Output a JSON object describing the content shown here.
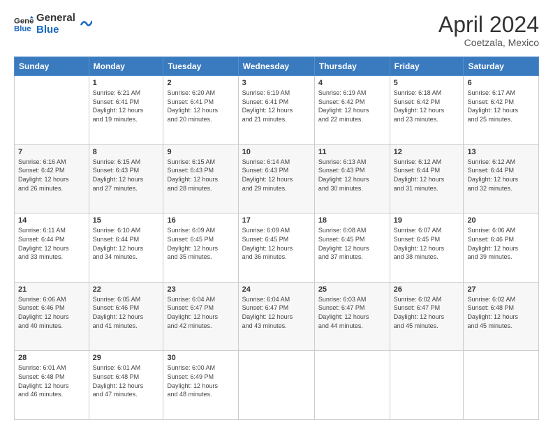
{
  "logo": {
    "line1": "General",
    "line2": "Blue"
  },
  "title": "April 2024",
  "subtitle": "Coetzala, Mexico",
  "days_header": [
    "Sunday",
    "Monday",
    "Tuesday",
    "Wednesday",
    "Thursday",
    "Friday",
    "Saturday"
  ],
  "weeks": [
    [
      {
        "day": "",
        "info": ""
      },
      {
        "day": "1",
        "info": "Sunrise: 6:21 AM\nSunset: 6:41 PM\nDaylight: 12 hours\nand 19 minutes."
      },
      {
        "day": "2",
        "info": "Sunrise: 6:20 AM\nSunset: 6:41 PM\nDaylight: 12 hours\nand 20 minutes."
      },
      {
        "day": "3",
        "info": "Sunrise: 6:19 AM\nSunset: 6:41 PM\nDaylight: 12 hours\nand 21 minutes."
      },
      {
        "day": "4",
        "info": "Sunrise: 6:19 AM\nSunset: 6:42 PM\nDaylight: 12 hours\nand 22 minutes."
      },
      {
        "day": "5",
        "info": "Sunrise: 6:18 AM\nSunset: 6:42 PM\nDaylight: 12 hours\nand 23 minutes."
      },
      {
        "day": "6",
        "info": "Sunrise: 6:17 AM\nSunset: 6:42 PM\nDaylight: 12 hours\nand 25 minutes."
      }
    ],
    [
      {
        "day": "7",
        "info": "Sunrise: 6:16 AM\nSunset: 6:42 PM\nDaylight: 12 hours\nand 26 minutes."
      },
      {
        "day": "8",
        "info": "Sunrise: 6:15 AM\nSunset: 6:43 PM\nDaylight: 12 hours\nand 27 minutes."
      },
      {
        "day": "9",
        "info": "Sunrise: 6:15 AM\nSunset: 6:43 PM\nDaylight: 12 hours\nand 28 minutes."
      },
      {
        "day": "10",
        "info": "Sunrise: 6:14 AM\nSunset: 6:43 PM\nDaylight: 12 hours\nand 29 minutes."
      },
      {
        "day": "11",
        "info": "Sunrise: 6:13 AM\nSunset: 6:43 PM\nDaylight: 12 hours\nand 30 minutes."
      },
      {
        "day": "12",
        "info": "Sunrise: 6:12 AM\nSunset: 6:44 PM\nDaylight: 12 hours\nand 31 minutes."
      },
      {
        "day": "13",
        "info": "Sunrise: 6:12 AM\nSunset: 6:44 PM\nDaylight: 12 hours\nand 32 minutes."
      }
    ],
    [
      {
        "day": "14",
        "info": "Sunrise: 6:11 AM\nSunset: 6:44 PM\nDaylight: 12 hours\nand 33 minutes."
      },
      {
        "day": "15",
        "info": "Sunrise: 6:10 AM\nSunset: 6:44 PM\nDaylight: 12 hours\nand 34 minutes."
      },
      {
        "day": "16",
        "info": "Sunrise: 6:09 AM\nSunset: 6:45 PM\nDaylight: 12 hours\nand 35 minutes."
      },
      {
        "day": "17",
        "info": "Sunrise: 6:09 AM\nSunset: 6:45 PM\nDaylight: 12 hours\nand 36 minutes."
      },
      {
        "day": "18",
        "info": "Sunrise: 6:08 AM\nSunset: 6:45 PM\nDaylight: 12 hours\nand 37 minutes."
      },
      {
        "day": "19",
        "info": "Sunrise: 6:07 AM\nSunset: 6:45 PM\nDaylight: 12 hours\nand 38 minutes."
      },
      {
        "day": "20",
        "info": "Sunrise: 6:06 AM\nSunset: 6:46 PM\nDaylight: 12 hours\nand 39 minutes."
      }
    ],
    [
      {
        "day": "21",
        "info": "Sunrise: 6:06 AM\nSunset: 6:46 PM\nDaylight: 12 hours\nand 40 minutes."
      },
      {
        "day": "22",
        "info": "Sunrise: 6:05 AM\nSunset: 6:46 PM\nDaylight: 12 hours\nand 41 minutes."
      },
      {
        "day": "23",
        "info": "Sunrise: 6:04 AM\nSunset: 6:47 PM\nDaylight: 12 hours\nand 42 minutes."
      },
      {
        "day": "24",
        "info": "Sunrise: 6:04 AM\nSunset: 6:47 PM\nDaylight: 12 hours\nand 43 minutes."
      },
      {
        "day": "25",
        "info": "Sunrise: 6:03 AM\nSunset: 6:47 PM\nDaylight: 12 hours\nand 44 minutes."
      },
      {
        "day": "26",
        "info": "Sunrise: 6:02 AM\nSunset: 6:47 PM\nDaylight: 12 hours\nand 45 minutes."
      },
      {
        "day": "27",
        "info": "Sunrise: 6:02 AM\nSunset: 6:48 PM\nDaylight: 12 hours\nand 45 minutes."
      }
    ],
    [
      {
        "day": "28",
        "info": "Sunrise: 6:01 AM\nSunset: 6:48 PM\nDaylight: 12 hours\nand 46 minutes."
      },
      {
        "day": "29",
        "info": "Sunrise: 6:01 AM\nSunset: 6:48 PM\nDaylight: 12 hours\nand 47 minutes."
      },
      {
        "day": "30",
        "info": "Sunrise: 6:00 AM\nSunset: 6:49 PM\nDaylight: 12 hours\nand 48 minutes."
      },
      {
        "day": "",
        "info": ""
      },
      {
        "day": "",
        "info": ""
      },
      {
        "day": "",
        "info": ""
      },
      {
        "day": "",
        "info": ""
      }
    ]
  ]
}
